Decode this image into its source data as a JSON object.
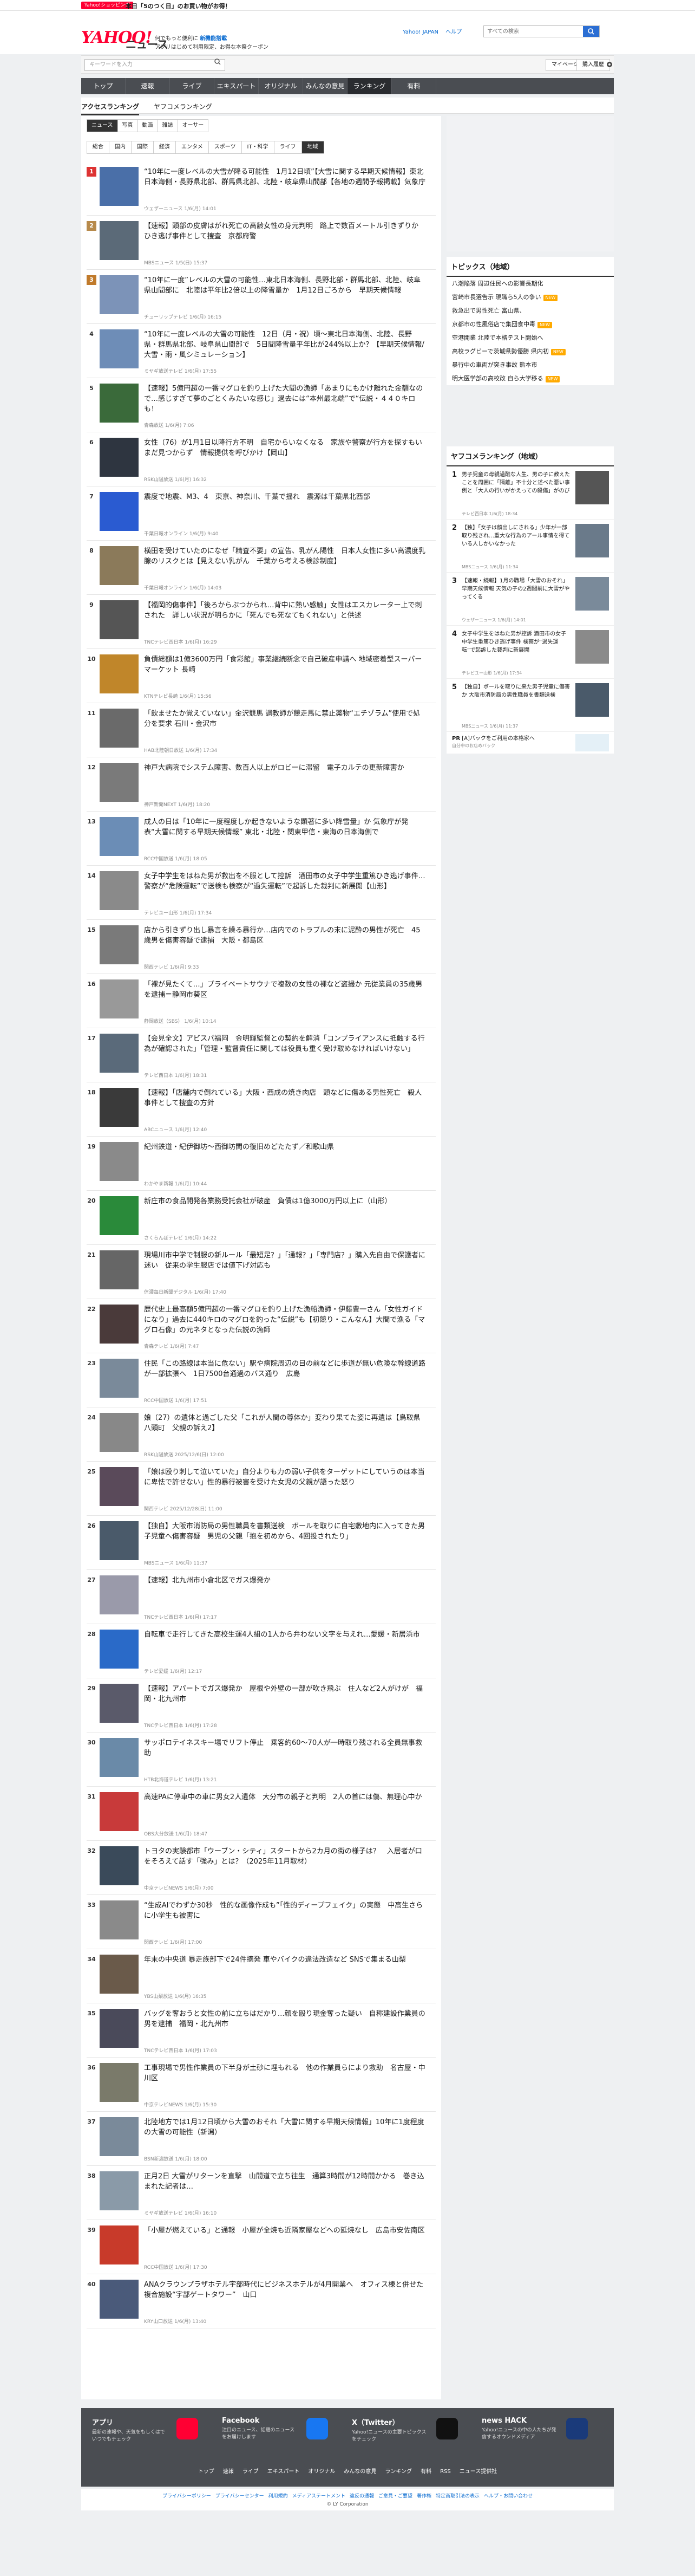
{
  "promo": {
    "tag": "Yahoo!ショッピング",
    "text": "本日「5のつく日」のお買い物がお得！"
  },
  "header": {
    "logo": "YAHOO!",
    "logo_sub": "ニュース",
    "logo_country": "JAPAN",
    "tagline_1": "何でもっと便利に",
    "tagline_link": "新機能搭載",
    "tagline_2": "アプリはじめて利用限定、お得な本祭クーポン",
    "links": [
      "Yahoo! JAPAN",
      "ヘルプ"
    ],
    "search_placeholder": "すべての検索"
  },
  "search": {
    "placeholder": "キーワードを入力",
    "mypage": "マイページ",
    "buy": "購入履歴"
  },
  "gnav": [
    "トップ",
    "速報",
    "ライブ",
    "エキスパート",
    "オリジナル",
    "みんなの意見",
    "ランキング",
    "有料"
  ],
  "gnav_active": "ランキング",
  "subnav": [
    "アクセスランキング",
    "ヤフコメランキング"
  ],
  "tabs1": [
    "ニュース",
    "写真",
    "動画",
    "雑誌",
    "オーサー"
  ],
  "tabs2": [
    "総合",
    "国内",
    "国際",
    "経済",
    "エンタメ",
    "スポーツ",
    "IT・科学",
    "ライフ",
    "地域"
  ],
  "tabs2_active": "地域",
  "ranking": [
    {
      "n": "1",
      "title": "“10年に一度レベルの大雪が降る可能性　1月12日頃”【大雪に関する早期天候情報】東北日本海側・長野県北部、群馬県北部、北陸・岐阜県山間部【各地の週間予報掲載】気象庁",
      "meta": "ウェザーニュース 1/6(月) 14:01",
      "color": "#4a6fa8"
    },
    {
      "n": "2",
      "title": "【速報】頭部の皮膚はがれ死亡の高齢女性の身元判明　路上で数百メートル引きずりか　ひき逃げ事件として捜査　京都府警",
      "meta": "MBSニュース 1/5(日) 15:37",
      "color": "#5b6a78"
    },
    {
      "n": "3",
      "title": "“10年に一度”レベルの大雪の可能性…東北日本海側、長野北部・群馬北部、北陸、岐阜県山間部に　北陸は平年比2倍以上の降雪量か　1月12日ごろから　早期天候情報",
      "meta": "チューリップテレビ 1/6(月) 16:15",
      "color": "#7c93b8"
    },
    {
      "n": "4",
      "title": "“10年に一度レベルの大雪の可能性　12日（月・祝）頃〜東北日本海側、北陸、長野県・群馬県北部、岐阜県山間部で　5日間降雪量平年比が244%以上か？【早期天候情報/大雪・雨・風シミュレーション】",
      "meta": "ミヤギ放送テレビ 1/6(月) 17:55",
      "color": "#6e8db7"
    },
    {
      "n": "5",
      "title": "【速報】5億円超の一番マグロを釣り上げた大間の漁師「あまりにもかけ離れた金額なので…感じすぎて夢のごとくみたいな感じ」過去には“本州最北端”で“伝説・４４０キロも！",
      "meta": "青森放送 1/6(月) 7:06",
      "color": "#3a6a3a"
    },
    {
      "n": "6",
      "title": "女性（76）が1月1日以降行方不明　自宅からいなくなる　家族や警察が行方を探すもいまだ見つからず　情報提供を呼びかけ【岡山】",
      "meta": "RSK山陽放送 1/6(月) 16:32",
      "color": "#2e3540"
    },
    {
      "n": "7",
      "title": "震度で地震、M3、4　東京、神奈川、千葉で揺れ　震源は千葉県北西部",
      "meta": "千葉日報オンライン 1/6(月) 9:40",
      "color": "#2a5bd1"
    },
    {
      "n": "8",
      "title": "横田を受けていたのになぜ「精査不要」の宣告、乳がん陽性　日本人女性に多い高濃度乳腺のリスクとは【見えない乳がん　千葉から考える検診制度】",
      "meta": "千葉日報オンライン 1/6(月) 14:03",
      "color": "#8b7a5a"
    },
    {
      "n": "9",
      "title": "【福岡的傷事件】「後ろからぶつかられ…背中に熱い感触」女性はエスカレーター上で刺された　詳しい状況が明らかに「死んでも死なてもくれない」と供述",
      "meta": "TNCテレビ西日本 1/6(月) 16:29",
      "color": "#555"
    },
    {
      "n": "10",
      "title": "負債総額は1億3600万円「食彩館」事業継続断念で自己破産申請へ 地域密着型スーパーマーケット 長崎",
      "meta": "KTNテレビ長崎 1/6(月) 15:56",
      "color": "#c0862a"
    },
    {
      "n": "11",
      "title": "「飲ませたか覚えていない」金沢競馬 調教師が競走馬に禁止薬物“エチゾラム”使用で処分を要求 石川・金沢市",
      "meta": "HAB北陸朝日放送 1/6(月) 17:34",
      "color": "#6a6a6a"
    },
    {
      "n": "12",
      "title": "神戸大病院でシステム障害、数百人以上がロビーに滞留　電子カルテの更新障害か",
      "meta": "神戸新聞NEXT 1/6(月) 18:20",
      "color": "#7a7a7a"
    },
    {
      "n": "13",
      "title": "成人の日は「10年に一度程度しか起きないような顕著に多い降雪量」か 気象庁が発表“大雪に関する早期天候情報” 東北・北陸・関東甲信・東海の日本海側で",
      "meta": "RCC中国放送 1/6(月) 18:05",
      "color": "#6b8db6"
    },
    {
      "n": "14",
      "title": "女子中学生をはねた男が救出を不服として控訴　酒田市の女子中学生重篤ひき逃げ事件…警察が“危険運転”で送検も検察が“過失運転”で起訴した裁判に新展開【山形】",
      "meta": "テレビユー山形 1/6(月) 17:34",
      "color": "#8a8a8a"
    },
    {
      "n": "15",
      "title": "店から引きずり出し暴言を繰る暴行か…店内でのトラブルの末に泥酔の男性が死亡　45歳男を傷害容疑で逮捕　大阪・都島区",
      "meta": "関西テレビ 1/6(月) 9:33",
      "color": "#7a7a7a"
    },
    {
      "n": "16",
      "title": "「裸が見たくて…」プライベートサウナで複数の女性の裸など盗撮か 元従業員の35歳男を逮捕＝静岡市葵区",
      "meta": "静岡放送（SBS） 1/6(月) 10:14",
      "color": "#999"
    },
    {
      "n": "17",
      "title": "【会見全文】アビスパ福岡　金明輝監督との契約を解消「コンプライアンスに抵触する行為が確認された」「管理・監督責任に関しては役員も重く受け取めなければいけない」",
      "meta": "テレビ西日本 1/6(月) 18:31",
      "color": "#5a6a7a"
    },
    {
      "n": "18",
      "title": "【速報】「店舗内で倒れている」大阪・西成の焼き肉店　頭などに傷ある男性死亡　殺人事件として捜査の方針",
      "meta": "ABCニュース 1/6(月) 12:40",
      "color": "#3a3a3a"
    },
    {
      "n": "19",
      "title": "紀州鉄道・紀伊御坊〜西御坊間の復旧めどたたず／和歌山県",
      "meta": "わかやま新報 1/6(月) 10:44",
      "color": "#8a8a8a"
    },
    {
      "n": "20",
      "title": "新庄市の食品開発各業務受託会社が破産　負債は1億3000万円以上に（山形）",
      "meta": "さくらんぼテレビ 1/6(月) 14:22",
      "color": "#2a8a3a"
    },
    {
      "n": "21",
      "title": "現場川市中学で制服の新ルール「最短足？」「通報？」「専門店？」購入先自由で保護者に迷い　従来の学生服店では値下げ対応も",
      "meta": "信濃毎日新聞デジタル 1/6(月) 17:40",
      "color": "#666"
    },
    {
      "n": "22",
      "title": "歴代史上最高額5億円超の一番マグロを釣り上げた漁船漁師・伊藤豊一さん「女性ガイドになり」過去に440キロのマグロを釣った“伝説”も【初競り・こんなん】大間で漁る「マグロ石像」の元ネタとなった伝説の漁師",
      "meta": "青森テレビ 1/6(月) 7:47",
      "color": "#4a3a3a"
    },
    {
      "n": "23",
      "title": "住民「この路線は本当に危ない」駅や病院周辺の目の前などに歩道が無い危険な幹線道路が一部拡張へ　1日7500台通過のバス通り　広島",
      "meta": "RCC中国放送 1/6(月) 17:51",
      "color": "#7a8a9a"
    },
    {
      "n": "24",
      "title": "娘（27）の遺体と過ごした父「これが人間の尊体か」変わり果てた姿に再遺は【鳥取県八頭町　父親の訴え2】",
      "meta": "RSK山陽放送 2025/12/6(日) 12:00",
      "color": "#888"
    },
    {
      "n": "25",
      "title": "「娘は殴り刺して泣いていた」自分よりも力の弱い子供をターゲットにしていうのは本当に卑怯で許せない」性的暴行被害を受けた女児の父親が語った怒り",
      "meta": "関西テレビ 2025/12/28(日) 11:00",
      "color": "#5a4a5a"
    },
    {
      "n": "26",
      "title": "【独自】大阪市消防局の男性職員を書類送検　ボールを取りに自宅敷地内に入ってきた男子児童へ傷害容疑　男児の父親「抱を初めから、4回投されたり」",
      "meta": "MBSニュース 1/6(月) 11:37",
      "color": "#4a5a6a"
    },
    {
      "n": "27",
      "title": "【速報】北九州市小倉北区でガス爆発か",
      "meta": "TNCテレビ西日本 1/6(月) 17:17",
      "color": "#9a9aaa"
    },
    {
      "n": "28",
      "title": "自転車で走行してきた高校生運4人組の1人から弁わない文字を与えれ…愛媛・新居浜市",
      "meta": "テレビ愛媛 1/6(月) 12:17",
      "color": "#2a6ac8"
    },
    {
      "n": "29",
      "title": "【速報】アパートでガス爆発か　屋根や外壁の一部が吹き飛ぶ　住人など2人がけが　福岡・北九州市",
      "meta": "TNCテレビ西日本 1/6(月) 17:28",
      "color": "#5a5a6a"
    },
    {
      "n": "30",
      "title": "サッポロテイネスキー場でリフト停止　乗客約60〜70人が一時取り残される全員無事救助",
      "meta": "HTB北海道テレビ 1/6(月) 13:21",
      "color": "#6a8aa8"
    },
    {
      "n": "31",
      "title": "高速PAに停車中の車に男女2人遺体　大分市の親子と判明　2人の首には傷、無理心中か",
      "meta": "OBS大分放送 1/6(月) 18:47",
      "color": "#c83a3a"
    },
    {
      "n": "32",
      "title": "トヨタの実験都市「ウーブン・シティ」スタートから2カ月の街の様子は？　入居者が口をそろえて話す「強み」とは？（2025年11月取材）",
      "meta": "中京テレビNEWS 1/6(月) 7:00",
      "color": "#3a4a5a"
    },
    {
      "n": "33",
      "title": "“生成AIでわずか30秒　性的な画像作成も”「性的ディープフェイク」の実態　中高生さらに小学生も被害に",
      "meta": "関西テレビ 1/6(月) 17:00",
      "color": "#8a8a8a"
    },
    {
      "n": "34",
      "title": "年末の中央道 暴走族部下で24件摘発 車やバイクの違法改造など SNSで集まる山梨",
      "meta": "YBS山梨放送 1/6(月) 16:35",
      "color": "#6a5a4a"
    },
    {
      "n": "35",
      "title": "バッグを奪おうと女性の前に立ちはだかり…顔を殴り現金奪った疑い　自称建設作業員の男を逮捕　福岡・北九州市",
      "meta": "TNCテレビ西日本 1/6(月) 17:03",
      "color": "#4a4a5a"
    },
    {
      "n": "36",
      "title": "工事現場で男性作業員の下半身が土砂に埋もれる　他の作業員らにより救助　名古屋・中川区",
      "meta": "中京テレビNEWS 1/6(月) 15:30",
      "color": "#7a7a6a"
    },
    {
      "n": "37",
      "title": "北陸地方では1月12日頃から大雪のおそれ「大雪に関する早期天候情報」10年に1度程度の大雪の可能性（新潟）",
      "meta": "BSN新潟放送 1/6(月) 18:00",
      "color": "#7a8a9a"
    },
    {
      "n": "38",
      "title": "正月2日 大雪がリターンを直撃　山間道で立ち往生　通算3時間が12時間かかる　巻き込まれた記者は…",
      "meta": "ミヤギ放送テレビ 1/6(月) 16:10",
      "color": "#8a9aa8"
    },
    {
      "n": "39",
      "title": "「小屋が燃えている」と通報　小屋が全焼も近隣家屋などへの延焼なし　広島市安佐南区",
      "meta": "RCC中国放送 1/6(月) 17:30",
      "color": "#c83a2a"
    },
    {
      "n": "40",
      "title": "ANAクラウンプラザホテル宇部時代にビジネスホテルが4月開業へ　オフィス棟と併せた複合施設“宇部ゲートタワー”　山口",
      "meta": "KRY山口放送 1/6(月) 13:40",
      "color": "#4a5a7a"
    }
  ],
  "topics": {
    "title": "トピックス（地域）",
    "items": [
      {
        "t": "八潮陥落 周辺住民への影響長期化",
        "new": ""
      },
      {
        "t": "宮崎市長選告示 現職ら5人の争い",
        "new": "NEW"
      },
      {
        "t": "救急出で男性死亡 富山県、",
        "new": ""
      },
      {
        "t": "京都市の性風俗店で集団食中毒",
        "new": "NEW"
      },
      {
        "t": "空港開業 北陸で本格テスト開始へ",
        "new": ""
      },
      {
        "t": "高校ラグビーで茨城県勢優勝 県内初",
        "new": "NEW"
      },
      {
        "t": "暴行中の車両が突き事故 熊本市",
        "new": ""
      },
      {
        "t": "明大医学部の高校改 自ら大学移る",
        "new": "NEW"
      }
    ]
  },
  "srank": {
    "title": "ヤフコメランキング（地域）",
    "items": [
      {
        "n": "1",
        "t": "男子児童の母親過酷な人生、男の子に教えたことを周囲に「隔離」不十分と述べた悪い事例と「大人の行いがかえっての殺傷」がのび",
        "m": "テレビ西日本 1/6(月) 18:34",
        "c": "#555"
      },
      {
        "n": "2",
        "t": "【独】「女子は顔出しにされる」少年が一部取り残され…重大な行為のアール事情を得ている人しかいなかった",
        "m": "MBSニュース 1/6(月) 11:34",
        "c": "#6a7a8a"
      },
      {
        "n": "3",
        "t": "【速報・続報】1月の職場「大雪のおそれ」早期天候情報 天気の子の2週間前に大雪がやってくる",
        "m": "ウェザーニュース 1/6(月) 14:01",
        "c": "#7a8a9a"
      },
      {
        "n": "4",
        "t": "女子中学生をはねた男が控訴 酒田市の女子中学生重篤ひき逃げ事件 検察が“過失運転”で起訴した裁判に新展開",
        "m": "テレビユー山形 1/6(月) 17:34",
        "c": "#8a8a8a"
      },
      {
        "n": "5",
        "t": "【独自】ボールを取りに来た男子児童に傷害か 大阪市消防局の男性職員を書類送検",
        "m": "MBSニュース 1/6(月) 11:37",
        "c": "#4a5a6a"
      }
    ],
    "pr_label": "PR",
    "pr_text": "[A]バックをご利用の本格家へ",
    "pr_meta": "自分中のお店めバック"
  },
  "footer": {
    "cols": [
      {
        "h": "アプリ",
        "d": "最新の速報や、天気をもしくはでいつでもチェック",
        "c": "#ff0033"
      },
      {
        "h": "Facebook",
        "d": "注目のニュース、話題のニュースをお届けします",
        "c": "#1877f2"
      },
      {
        "h": "X（Twitter）",
        "d": "Yahoo!ニュースの主要トピックスをチェック",
        "c": "#111"
      },
      {
        "h": "news HACK",
        "d": "Yahoo!ニュースの中の人たちが発信するオウンドメディア",
        "c": "#1a3a7a"
      }
    ],
    "nav": [
      "トップ",
      "速報",
      "ライブ",
      "エキスパート",
      "オリジナル",
      "みんなの意見",
      "ランキング",
      "有料",
      "RSS",
      "ニュース提供社"
    ],
    "links": [
      "プライバシーポリシー",
      "プライバシーセンター",
      "利用規約",
      "メディアステートメント",
      "違反の通報",
      "ご意見・ご要望",
      "著作権",
      "特定商取引法の表示",
      "ヘルプ・お問い合わせ"
    ],
    "copyright": "© LY Corporation"
  }
}
